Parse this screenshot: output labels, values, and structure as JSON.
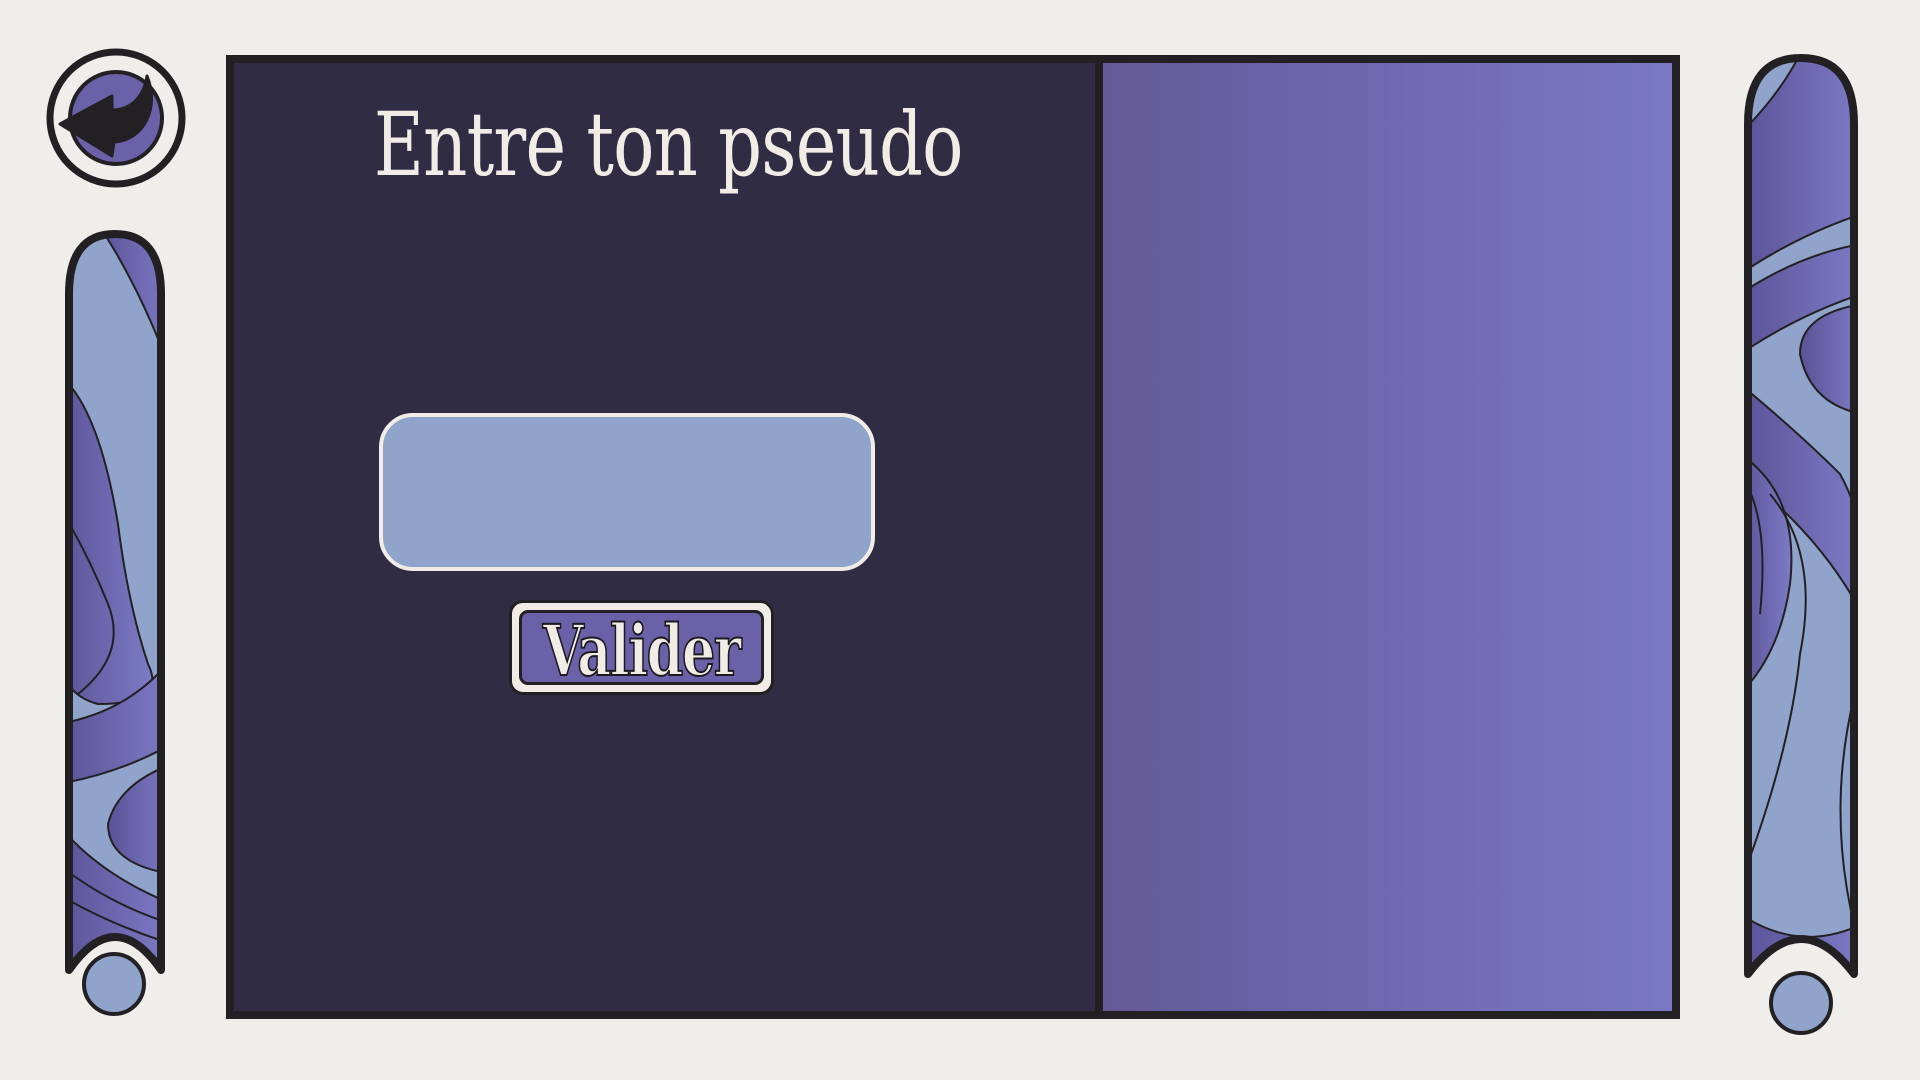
{
  "title": "Entre ton pseudo",
  "pseudo_input": {
    "value": "",
    "placeholder": ""
  },
  "validate_button": {
    "label": "Valider"
  },
  "icons": {
    "back": "back-arrow-icon"
  },
  "colors": {
    "background": "#f0eeeb",
    "panel_dark": "#302c44",
    "panel_gradient_start": "#645a96",
    "panel_gradient_end": "#7b78c4",
    "input_fill": "#90a3cb",
    "accent_purple": "#6a61a8",
    "text_light": "#f1ede6",
    "outline": "#222023"
  }
}
